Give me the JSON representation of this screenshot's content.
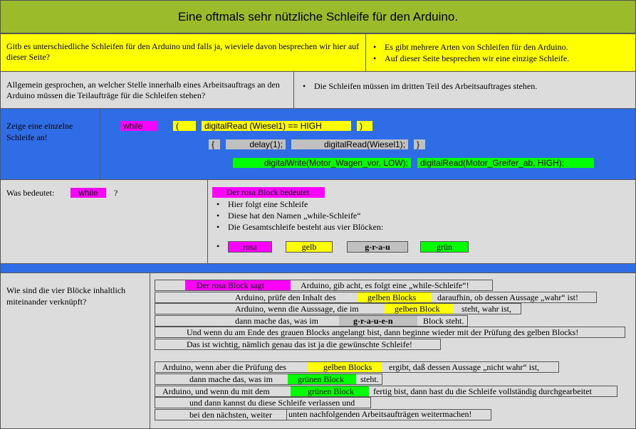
{
  "title": "Eine oftmals sehr nützliche Schleife für den Arduino.",
  "colors": {
    "title_bg": "#9bbb2b",
    "yellow": "#ffff00",
    "gray": "#dcdcdc",
    "blue": "#2f6de6",
    "pink": "#ff00ff",
    "green": "#00ff00"
  },
  "row1": {
    "question": "Gitb es unterschiedliche Schleifen für den Arduino und falls ja, wieviele davon besprechen wir hier auf dieser Seite?",
    "answers": [
      "Es gibt mehrere Arten von Schleifen für den Arduino.",
      "Auf dieser Seite besprechen wir eine einzige Schleife."
    ]
  },
  "row2": {
    "question": "Allgemein gesprochen, an welcher Stelle innerhalb eines Arbeitsauftrags an den Arduino müssen die Teilaufträge für die Schleifen stehen?",
    "answer": "Die Schleifen müssen im dritten Teil des Arbeitsauftrages stehen."
  },
  "row3": {
    "question": "Zeige eine einzelne Schleife an!",
    "code": {
      "while": "while",
      "open_paren": "(",
      "condition": "digitalRead (Wiesel1)  ==  HIGH",
      "close_paren": ")",
      "open_brace": "{",
      "delay": "delay(1);",
      "read": "digitalRead(Wiesel1);",
      "close_brace": "}",
      "write": "digitalWrite(Motor_Wagen_vor, LOW);",
      "read2": "digitalRead(Motor_Greifer_ab, HIGH);"
    }
  },
  "row4": {
    "question_prefix": "Was bedeutet:",
    "question_chip": "while",
    "question_suffix": "?",
    "pink_block": "Der rosa  Block bedeutet",
    "bullets": [
      "Hier folgt eine Schleife",
      "Diese hat den Namen „while-Schleife“",
      "Die Gesamtschleife besteht aus vier Blöcken:"
    ],
    "blocks": [
      "rosa",
      "gelb",
      "g-r-a-u",
      "grün"
    ]
  },
  "row5": {
    "question": "Wie sind die vier Blöcke inhaltlich miteinander verknüpft?",
    "lines1": [
      {
        "a": "Der rosa Block sagt",
        "b": "Arduino, gib acht, es  folgt eine „while-Schleife“!"
      },
      {
        "a": "Arduino, prüfe den Inhalt des",
        "b": "gelben Blocks",
        "c": "daraufhin, ob dessen Aussage „wahr“ ist!"
      },
      {
        "a": "Arduino, wenn die Ausssage,  die im",
        "b": "gelben Block",
        "c": "steht,  wahr ist,"
      },
      {
        "a": "dann mache das,  was im",
        "b": "g-r-a-u-e-n",
        "c": "Block steht."
      },
      {
        "a": "Und wenn du am Ende des grauen Blocks angelangt bist, dann beginne wieder mit der Prüfung des gelben Blocks!"
      },
      {
        "a": "Das ist wichtig, nämlich genau das ist ja die gewünschte Schleife!"
      }
    ],
    "lines2": [
      {
        "a": "Arduino, wenn aber die Prüfung des",
        "b": "gelben Blocks",
        "c": "ergibt, daß dessen Aussage „nicht wahr“ ist,"
      },
      {
        "a": "dann  mache das, was im",
        "b": "grünen Block",
        "c": "steht."
      },
      {
        "a": "Arduino, und wenn du mit dem",
        "b": "grünen Block",
        "c": "fertig bist, dann hast du die Schleife vollständig durchgearbeitet"
      },
      {
        "a": "und dann kannst du diese Schleife verlassen und"
      },
      {
        "a": "bei den nächsten,  weiter",
        "b": "unten nachfolgenden Arbeitsaufträgen weitermachen!"
      }
    ]
  }
}
